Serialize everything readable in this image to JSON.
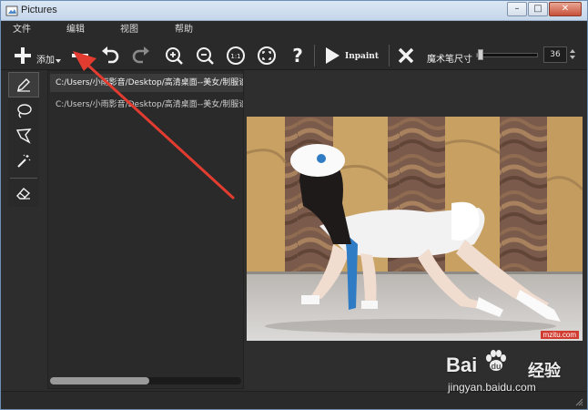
{
  "window": {
    "title": "Pictures"
  },
  "window_controls": {
    "minimize": "–",
    "maximize": "□",
    "close": "✕"
  },
  "menu": [
    "文件",
    "编辑",
    "视图",
    "帮助"
  ],
  "toolbar": {
    "add_label": "添加",
    "inpaint_label": "Inpaint",
    "brush_size_label": "魔术笔尺寸",
    "brush_size_value": "36",
    "brush_size_fraction": 0.05,
    "icons": [
      "plus-icon",
      "minus-icon",
      "undo-icon",
      "redo-icon",
      "zoom-in-icon",
      "zoom-out-icon",
      "actual-size-icon",
      "fit-window-icon",
      "help-icon",
      "play-icon",
      "x-icon"
    ]
  },
  "tools": [
    "pencil-icon",
    "lasso-icon",
    "polygon-lasso-icon",
    "magic-wand-icon",
    "eraser-icon"
  ],
  "files": [
    {
      "path": "C:/Users/小雨影音/Desktop/高清桌面--美女/制服诱惑",
      "selected": true
    },
    {
      "path": "C:/Users/小雨影音/Desktop/高清桌面--美女/制服诱惑",
      "selected": false
    }
  ],
  "file_list_scroll_fraction": 0.52,
  "image": {
    "watermark": "mzitu.com"
  },
  "overlay_watermark": {
    "logo": "Bai",
    "logo_tail": "du",
    "jingyan": "经验",
    "url": "jingyan.baidu.com"
  },
  "colors": {
    "background": "#2d2d2d",
    "annotation_arrow": "#e23c30",
    "titlebar": "#c5d6ea"
  }
}
